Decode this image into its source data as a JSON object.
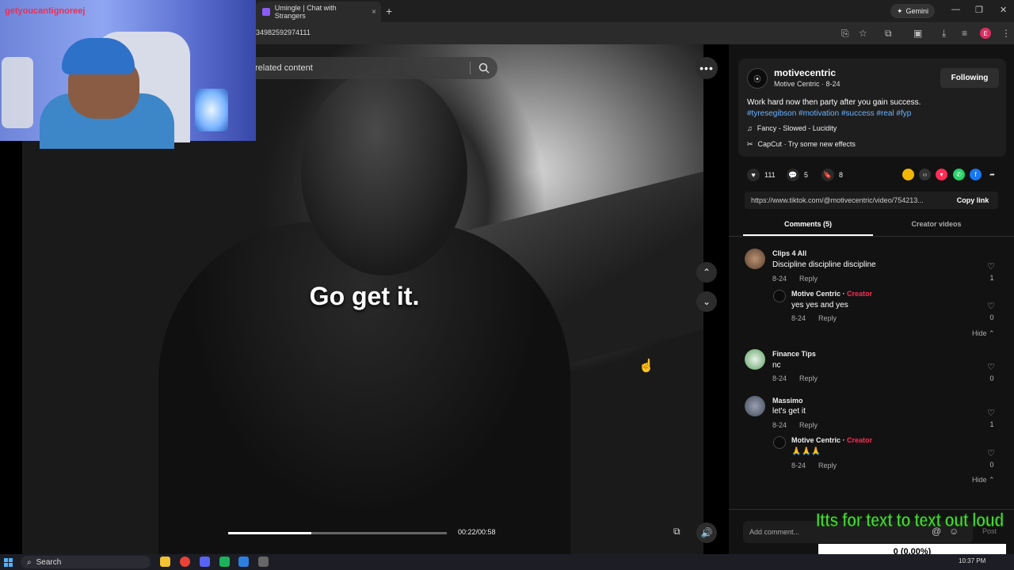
{
  "browser": {
    "tab_title": "Umingle | Chat with Strangers",
    "tab_close": "×",
    "new_tab": "+",
    "gemini_label": "Gemini",
    "url_fragment": "34982592974111",
    "profile_initial": "E",
    "win_min": "—",
    "win_max": "❐",
    "win_close": "✕"
  },
  "webcam": {
    "overlay_name": "getyoucantignoreej"
  },
  "video": {
    "search_placeholder": "related content",
    "more_label": "•••",
    "caption": "Go get it.",
    "time": "00:22/00:58",
    "progress": 0.3793
  },
  "post": {
    "author": "motivecentric",
    "subtitle": "Motive Centric · 8-24",
    "follow_label": "Following",
    "description": "Work hard now then party after you gain success.",
    "hashtags": "#tyresegibson #motivation #success #real #fyp",
    "music": "Fancy - Slowed - Lucidity",
    "capcut": "CapCut · Try some new effects",
    "likes": "111",
    "comments": "5",
    "saves": "8",
    "link": "https://www.tiktok.com/@motivecentric/video/754213...",
    "copy_label": "Copy link"
  },
  "tabs": {
    "comments": "Comments (5)",
    "creator": "Creator videos"
  },
  "comments": [
    {
      "name": "Clips 4 All",
      "text": "Discipline discipline discipline",
      "date": "8-24",
      "reply": "Reply",
      "likes": "1"
    },
    {
      "name": "Motive Centric",
      "tag": "Creator",
      "text": "yes yes and yes",
      "date": "8-24",
      "reply": "Reply",
      "likes": "0"
    },
    {
      "name": "Finance Tips",
      "text": "nc",
      "date": "8-24",
      "reply": "Reply",
      "likes": "0"
    },
    {
      "name": "Massimo",
      "text": "let's get it",
      "date": "8-24",
      "reply": "Reply",
      "likes": "1"
    },
    {
      "name": "Motive Centric",
      "tag": "Creator",
      "text": "🙏🙏🙏",
      "date": "8-24",
      "reply": "Reply",
      "likes": "0"
    }
  ],
  "hide_label": "Hide",
  "creator_sep": " · ",
  "add_comment_placeholder": "Add comment...",
  "post_label": "Post",
  "tts": {
    "text": "Itts for text to text out loud",
    "amount": "0 (0.00%)"
  },
  "taskbar": {
    "search_label": "Search",
    "clock": "10:37 PM"
  },
  "colors": {
    "accent_red": "#fe2c55",
    "hashtag_blue": "#6ab3ff",
    "tts_green": "#4ade3a"
  }
}
